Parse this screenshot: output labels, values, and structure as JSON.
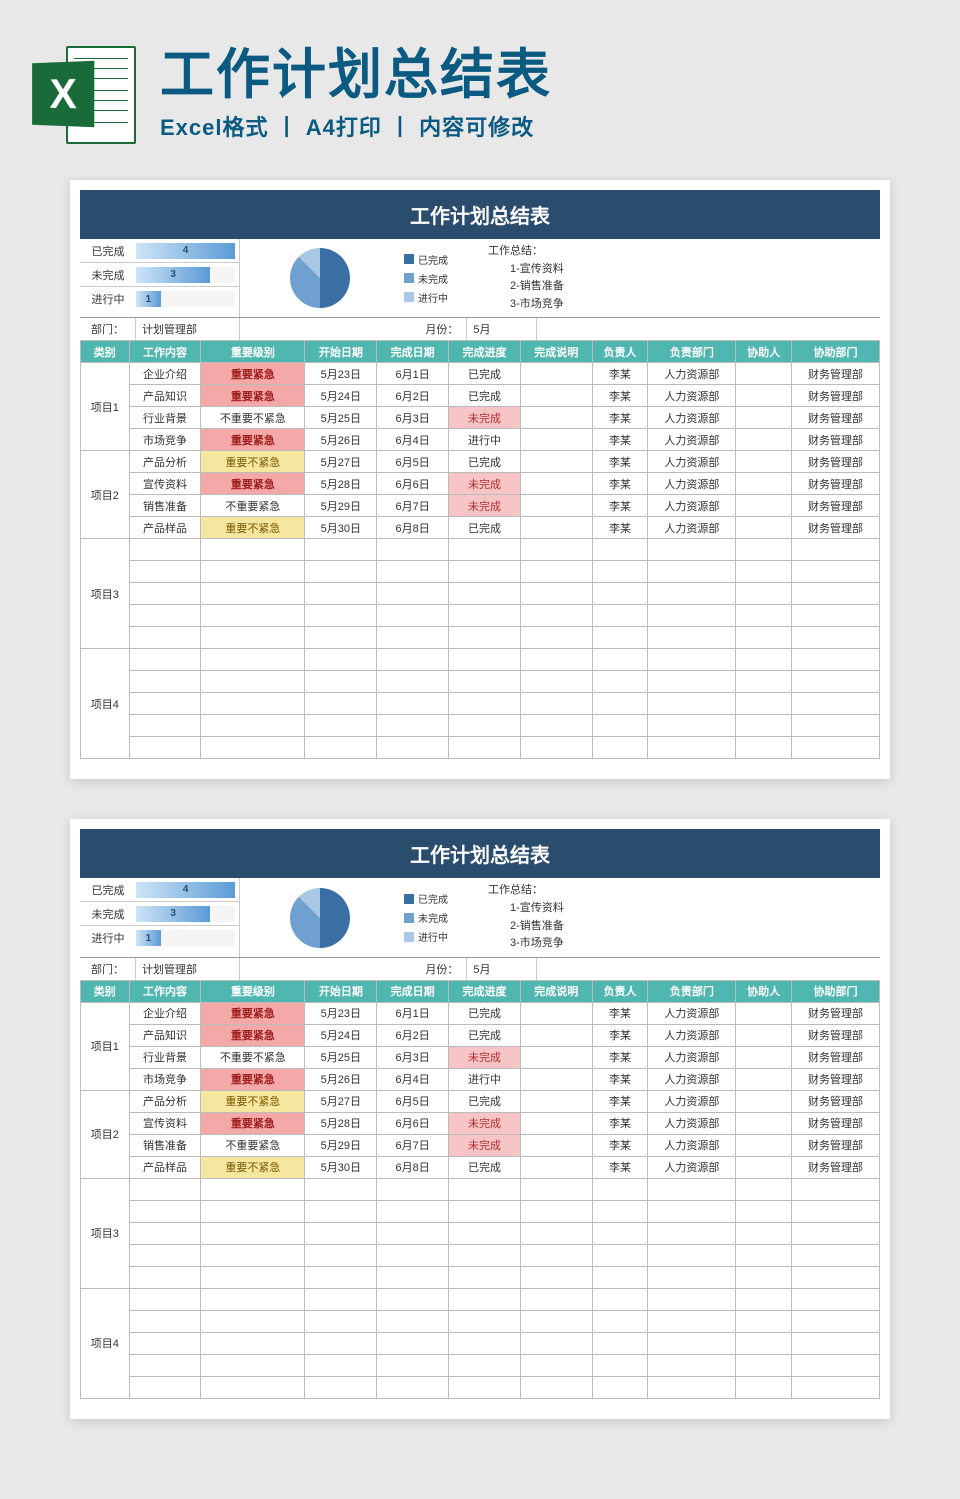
{
  "header": {
    "title": "工作计划总结表",
    "subtitle": "Excel格式 丨 A4打印 丨 内容可修改",
    "icon_letter": "X"
  },
  "sheet": {
    "title": "工作计划总结表",
    "stats": [
      {
        "label": "已完成",
        "value": 4,
        "pct": 100
      },
      {
        "label": "未完成",
        "value": 3,
        "pct": 75
      },
      {
        "label": "进行中",
        "value": 1,
        "pct": 25
      }
    ],
    "legend": [
      "已完成",
      "未完成",
      "进行中"
    ],
    "summary_title": "工作总结：",
    "summary_items": [
      "1-宣传资料",
      "2-销售准备",
      "3-市场竞争"
    ],
    "meta": {
      "dept_label": "部门：",
      "dept_value": "计划管理部",
      "month_label": "月份：",
      "month_value": "5月"
    },
    "columns": [
      "类别",
      "工作内容",
      "重要级别",
      "开始日期",
      "完成日期",
      "完成进度",
      "完成说明",
      "负责人",
      "负责部门",
      "协助人",
      "协助部门"
    ],
    "groups": [
      {
        "name": "项目1",
        "rows": [
          {
            "content": "企业介绍",
            "importance": "重要紧急",
            "imp_cls": "imp-red",
            "start": "5月23日",
            "end": "6月1日",
            "progress": "已完成",
            "prog_cls": "prog-norm",
            "note": "",
            "owner": "李某",
            "dept": "人力资源部",
            "helper": "",
            "helpdept": "财务管理部"
          },
          {
            "content": "产品知识",
            "importance": "重要紧急",
            "imp_cls": "imp-red",
            "start": "5月24日",
            "end": "6月2日",
            "progress": "已完成",
            "prog_cls": "prog-norm",
            "note": "",
            "owner": "李某",
            "dept": "人力资源部",
            "helper": "",
            "helpdept": "财务管理部"
          },
          {
            "content": "行业背景",
            "importance": "不重要不紧急",
            "imp_cls": "imp-none",
            "start": "5月25日",
            "end": "6月3日",
            "progress": "未完成",
            "prog_cls": "prog-red",
            "note": "",
            "owner": "李某",
            "dept": "人力资源部",
            "helper": "",
            "helpdept": "财务管理部"
          },
          {
            "content": "市场竞争",
            "importance": "重要紧急",
            "imp_cls": "imp-red",
            "start": "5月26日",
            "end": "6月4日",
            "progress": "进行中",
            "prog_cls": "prog-norm",
            "note": "",
            "owner": "李某",
            "dept": "人力资源部",
            "helper": "",
            "helpdept": "财务管理部"
          }
        ]
      },
      {
        "name": "项目2",
        "rows": [
          {
            "content": "产品分析",
            "importance": "重要不紧急",
            "imp_cls": "imp-yellow",
            "start": "5月27日",
            "end": "6月5日",
            "progress": "已完成",
            "prog_cls": "prog-norm",
            "note": "",
            "owner": "李某",
            "dept": "人力资源部",
            "helper": "",
            "helpdept": "财务管理部"
          },
          {
            "content": "宣传资料",
            "importance": "重要紧急",
            "imp_cls": "imp-red",
            "start": "5月28日",
            "end": "6月6日",
            "progress": "未完成",
            "prog_cls": "prog-red",
            "note": "",
            "owner": "李某",
            "dept": "人力资源部",
            "helper": "",
            "helpdept": "财务管理部"
          },
          {
            "content": "销售准备",
            "importance": "不重要紧急",
            "imp_cls": "imp-none",
            "start": "5月29日",
            "end": "6月7日",
            "progress": "未完成",
            "prog_cls": "prog-red",
            "note": "",
            "owner": "李某",
            "dept": "人力资源部",
            "helper": "",
            "helpdept": "财务管理部"
          },
          {
            "content": "产品样品",
            "importance": "重要不紧急",
            "imp_cls": "imp-yellow",
            "start": "5月30日",
            "end": "6月8日",
            "progress": "已完成",
            "prog_cls": "prog-norm",
            "note": "",
            "owner": "李某",
            "dept": "人力资源部",
            "helper": "",
            "helpdept": "财务管理部"
          }
        ]
      },
      {
        "name": "项目3",
        "rows": [
          {},
          {},
          {},
          {},
          {}
        ]
      },
      {
        "name": "项目4",
        "rows": [
          {},
          {},
          {},
          {},
          {}
        ]
      }
    ]
  },
  "chart_data": {
    "type": "pie",
    "title": "",
    "series": [
      {
        "name": "状态",
        "values": [
          4,
          3,
          1
        ]
      }
    ],
    "categories": [
      "已完成",
      "未完成",
      "进行中"
    ]
  }
}
